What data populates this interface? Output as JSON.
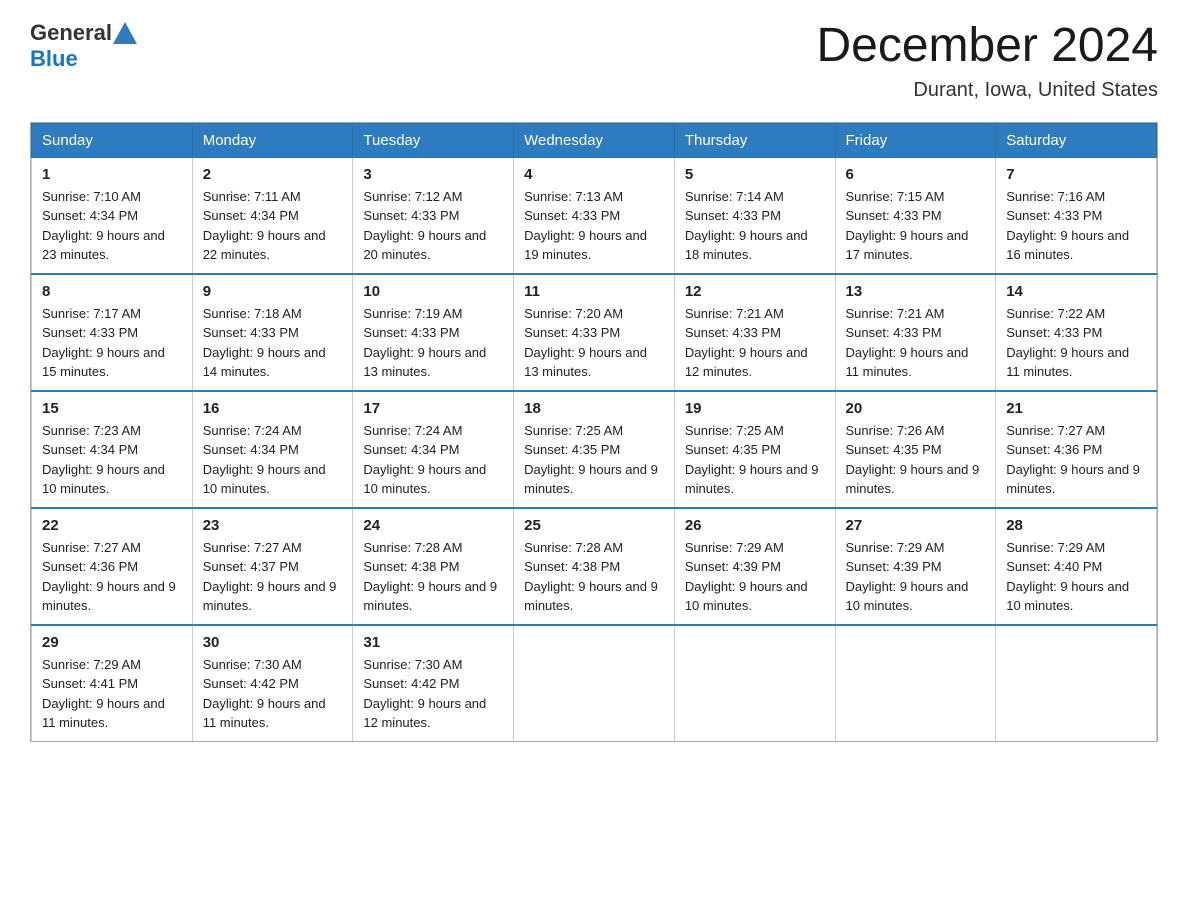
{
  "header": {
    "logo_general": "General",
    "logo_blue": "Blue",
    "month_title": "December 2024",
    "location": "Durant, Iowa, United States"
  },
  "days_of_week": [
    "Sunday",
    "Monday",
    "Tuesday",
    "Wednesday",
    "Thursday",
    "Friday",
    "Saturday"
  ],
  "weeks": [
    [
      {
        "day": "1",
        "sunrise": "7:10 AM",
        "sunset": "4:34 PM",
        "daylight": "9 hours and 23 minutes."
      },
      {
        "day": "2",
        "sunrise": "7:11 AM",
        "sunset": "4:34 PM",
        "daylight": "9 hours and 22 minutes."
      },
      {
        "day": "3",
        "sunrise": "7:12 AM",
        "sunset": "4:33 PM",
        "daylight": "9 hours and 20 minutes."
      },
      {
        "day": "4",
        "sunrise": "7:13 AM",
        "sunset": "4:33 PM",
        "daylight": "9 hours and 19 minutes."
      },
      {
        "day": "5",
        "sunrise": "7:14 AM",
        "sunset": "4:33 PM",
        "daylight": "9 hours and 18 minutes."
      },
      {
        "day": "6",
        "sunrise": "7:15 AM",
        "sunset": "4:33 PM",
        "daylight": "9 hours and 17 minutes."
      },
      {
        "day": "7",
        "sunrise": "7:16 AM",
        "sunset": "4:33 PM",
        "daylight": "9 hours and 16 minutes."
      }
    ],
    [
      {
        "day": "8",
        "sunrise": "7:17 AM",
        "sunset": "4:33 PM",
        "daylight": "9 hours and 15 minutes."
      },
      {
        "day": "9",
        "sunrise": "7:18 AM",
        "sunset": "4:33 PM",
        "daylight": "9 hours and 14 minutes."
      },
      {
        "day": "10",
        "sunrise": "7:19 AM",
        "sunset": "4:33 PM",
        "daylight": "9 hours and 13 minutes."
      },
      {
        "day": "11",
        "sunrise": "7:20 AM",
        "sunset": "4:33 PM",
        "daylight": "9 hours and 13 minutes."
      },
      {
        "day": "12",
        "sunrise": "7:21 AM",
        "sunset": "4:33 PM",
        "daylight": "9 hours and 12 minutes."
      },
      {
        "day": "13",
        "sunrise": "7:21 AM",
        "sunset": "4:33 PM",
        "daylight": "9 hours and 11 minutes."
      },
      {
        "day": "14",
        "sunrise": "7:22 AM",
        "sunset": "4:33 PM",
        "daylight": "9 hours and 11 minutes."
      }
    ],
    [
      {
        "day": "15",
        "sunrise": "7:23 AM",
        "sunset": "4:34 PM",
        "daylight": "9 hours and 10 minutes."
      },
      {
        "day": "16",
        "sunrise": "7:24 AM",
        "sunset": "4:34 PM",
        "daylight": "9 hours and 10 minutes."
      },
      {
        "day": "17",
        "sunrise": "7:24 AM",
        "sunset": "4:34 PM",
        "daylight": "9 hours and 10 minutes."
      },
      {
        "day": "18",
        "sunrise": "7:25 AM",
        "sunset": "4:35 PM",
        "daylight": "9 hours and 9 minutes."
      },
      {
        "day": "19",
        "sunrise": "7:25 AM",
        "sunset": "4:35 PM",
        "daylight": "9 hours and 9 minutes."
      },
      {
        "day": "20",
        "sunrise": "7:26 AM",
        "sunset": "4:35 PM",
        "daylight": "9 hours and 9 minutes."
      },
      {
        "day": "21",
        "sunrise": "7:27 AM",
        "sunset": "4:36 PM",
        "daylight": "9 hours and 9 minutes."
      }
    ],
    [
      {
        "day": "22",
        "sunrise": "7:27 AM",
        "sunset": "4:36 PM",
        "daylight": "9 hours and 9 minutes."
      },
      {
        "day": "23",
        "sunrise": "7:27 AM",
        "sunset": "4:37 PM",
        "daylight": "9 hours and 9 minutes."
      },
      {
        "day": "24",
        "sunrise": "7:28 AM",
        "sunset": "4:38 PM",
        "daylight": "9 hours and 9 minutes."
      },
      {
        "day": "25",
        "sunrise": "7:28 AM",
        "sunset": "4:38 PM",
        "daylight": "9 hours and 9 minutes."
      },
      {
        "day": "26",
        "sunrise": "7:29 AM",
        "sunset": "4:39 PM",
        "daylight": "9 hours and 10 minutes."
      },
      {
        "day": "27",
        "sunrise": "7:29 AM",
        "sunset": "4:39 PM",
        "daylight": "9 hours and 10 minutes."
      },
      {
        "day": "28",
        "sunrise": "7:29 AM",
        "sunset": "4:40 PM",
        "daylight": "9 hours and 10 minutes."
      }
    ],
    [
      {
        "day": "29",
        "sunrise": "7:29 AM",
        "sunset": "4:41 PM",
        "daylight": "9 hours and 11 minutes."
      },
      {
        "day": "30",
        "sunrise": "7:30 AM",
        "sunset": "4:42 PM",
        "daylight": "9 hours and 11 minutes."
      },
      {
        "day": "31",
        "sunrise": "7:30 AM",
        "sunset": "4:42 PM",
        "daylight": "9 hours and 12 minutes."
      },
      null,
      null,
      null,
      null
    ]
  ]
}
